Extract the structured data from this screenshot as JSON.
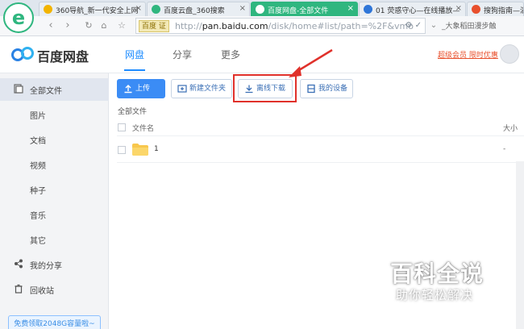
{
  "browser": {
    "tabs": [
      {
        "title": "360导航_新一代安全上网",
        "favicon_color": "#f2b400"
      },
      {
        "title": "百度云盘_360搜索",
        "favicon_color": "#2fb67f"
      },
      {
        "title": "百度网盘-全部文件",
        "favicon_color": "#3b8cf5"
      },
      {
        "title": "01 荧惑守心—在线播放—",
        "favicon_color": "#2f76d8"
      },
      {
        "title": "搜狗指南—满",
        "favicon_color": "#e8502d"
      }
    ],
    "close_glyph": "×",
    "address": {
      "badge": "百度 证",
      "url_host": "pan.baidu.com",
      "url_prefix": "http://",
      "url_path": "/disk/home#list/path=%2F&vmo"
    },
    "search_suggest": "_大象稻田漫步触"
  },
  "header": {
    "logo_text": "百度网盘",
    "nav": [
      "网盘",
      "分享",
      "更多"
    ],
    "vip_link": "超级会员 限时优惠"
  },
  "sidebar": {
    "items": [
      {
        "label": "全部文件",
        "icon": "files-icon"
      },
      {
        "label": "图片"
      },
      {
        "label": "文档"
      },
      {
        "label": "视频"
      },
      {
        "label": "种子"
      },
      {
        "label": "音乐"
      },
      {
        "label": "其它"
      },
      {
        "label": "我的分享",
        "icon": "share-icon"
      },
      {
        "label": "回收站",
        "icon": "trash-icon"
      }
    ],
    "promo": "免费领取2048G容量啦~"
  },
  "toolbar": {
    "upload": "上传",
    "new_folder": "新建文件夹",
    "offline_download": "离线下载",
    "my_devices": "我的设备"
  },
  "files": {
    "breadcrumb": "全部文件",
    "col_name": "文件名",
    "col_size": "大小",
    "rows": [
      {
        "name": "1",
        "size": "-"
      }
    ]
  },
  "watermark": {
    "title": "百科全说",
    "subtitle": "助你轻松解决"
  },
  "colors": {
    "accent": "#1e8cff",
    "highlight": "#e0312b",
    "active_tab": "#2fb67f"
  }
}
